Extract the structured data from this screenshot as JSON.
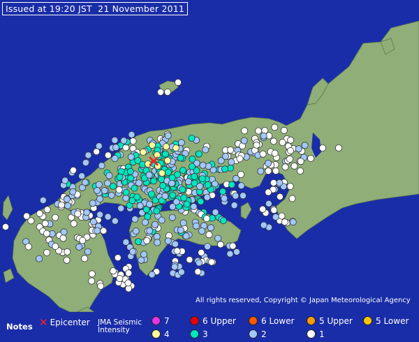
{
  "header": {
    "issued": "Issued at 19:20 JST  21 November 2011"
  },
  "copyright": "All rights reserved, Copyright © Japan Meteorological Agency",
  "legend": {
    "notes": "Notes",
    "epicenter": "Epicenter",
    "jma_title": "JMA Seismic Intensity",
    "items": [
      {
        "label": "7",
        "color": "#e733e7"
      },
      {
        "label": "6 Upper",
        "color": "#e8000f"
      },
      {
        "label": "6 Lower",
        "color": "#ff5a00"
      },
      {
        "label": "5 Upper",
        "color": "#ff9b00"
      },
      {
        "label": "5 Lower",
        "color": "#ffc600"
      },
      {
        "label": "4",
        "color": "#fffb99"
      },
      {
        "label": "3",
        "color": "#00e6c0"
      },
      {
        "label": "2",
        "color": "#a2c8ff"
      },
      {
        "label": "1",
        "color": "#ffffff"
      }
    ]
  },
  "map": {
    "land_color": "#8fae78",
    "sea_color": "#1a2da8",
    "epicenter_color": "#ff2020",
    "epicenter_icon": "x-mark-icon"
  }
}
